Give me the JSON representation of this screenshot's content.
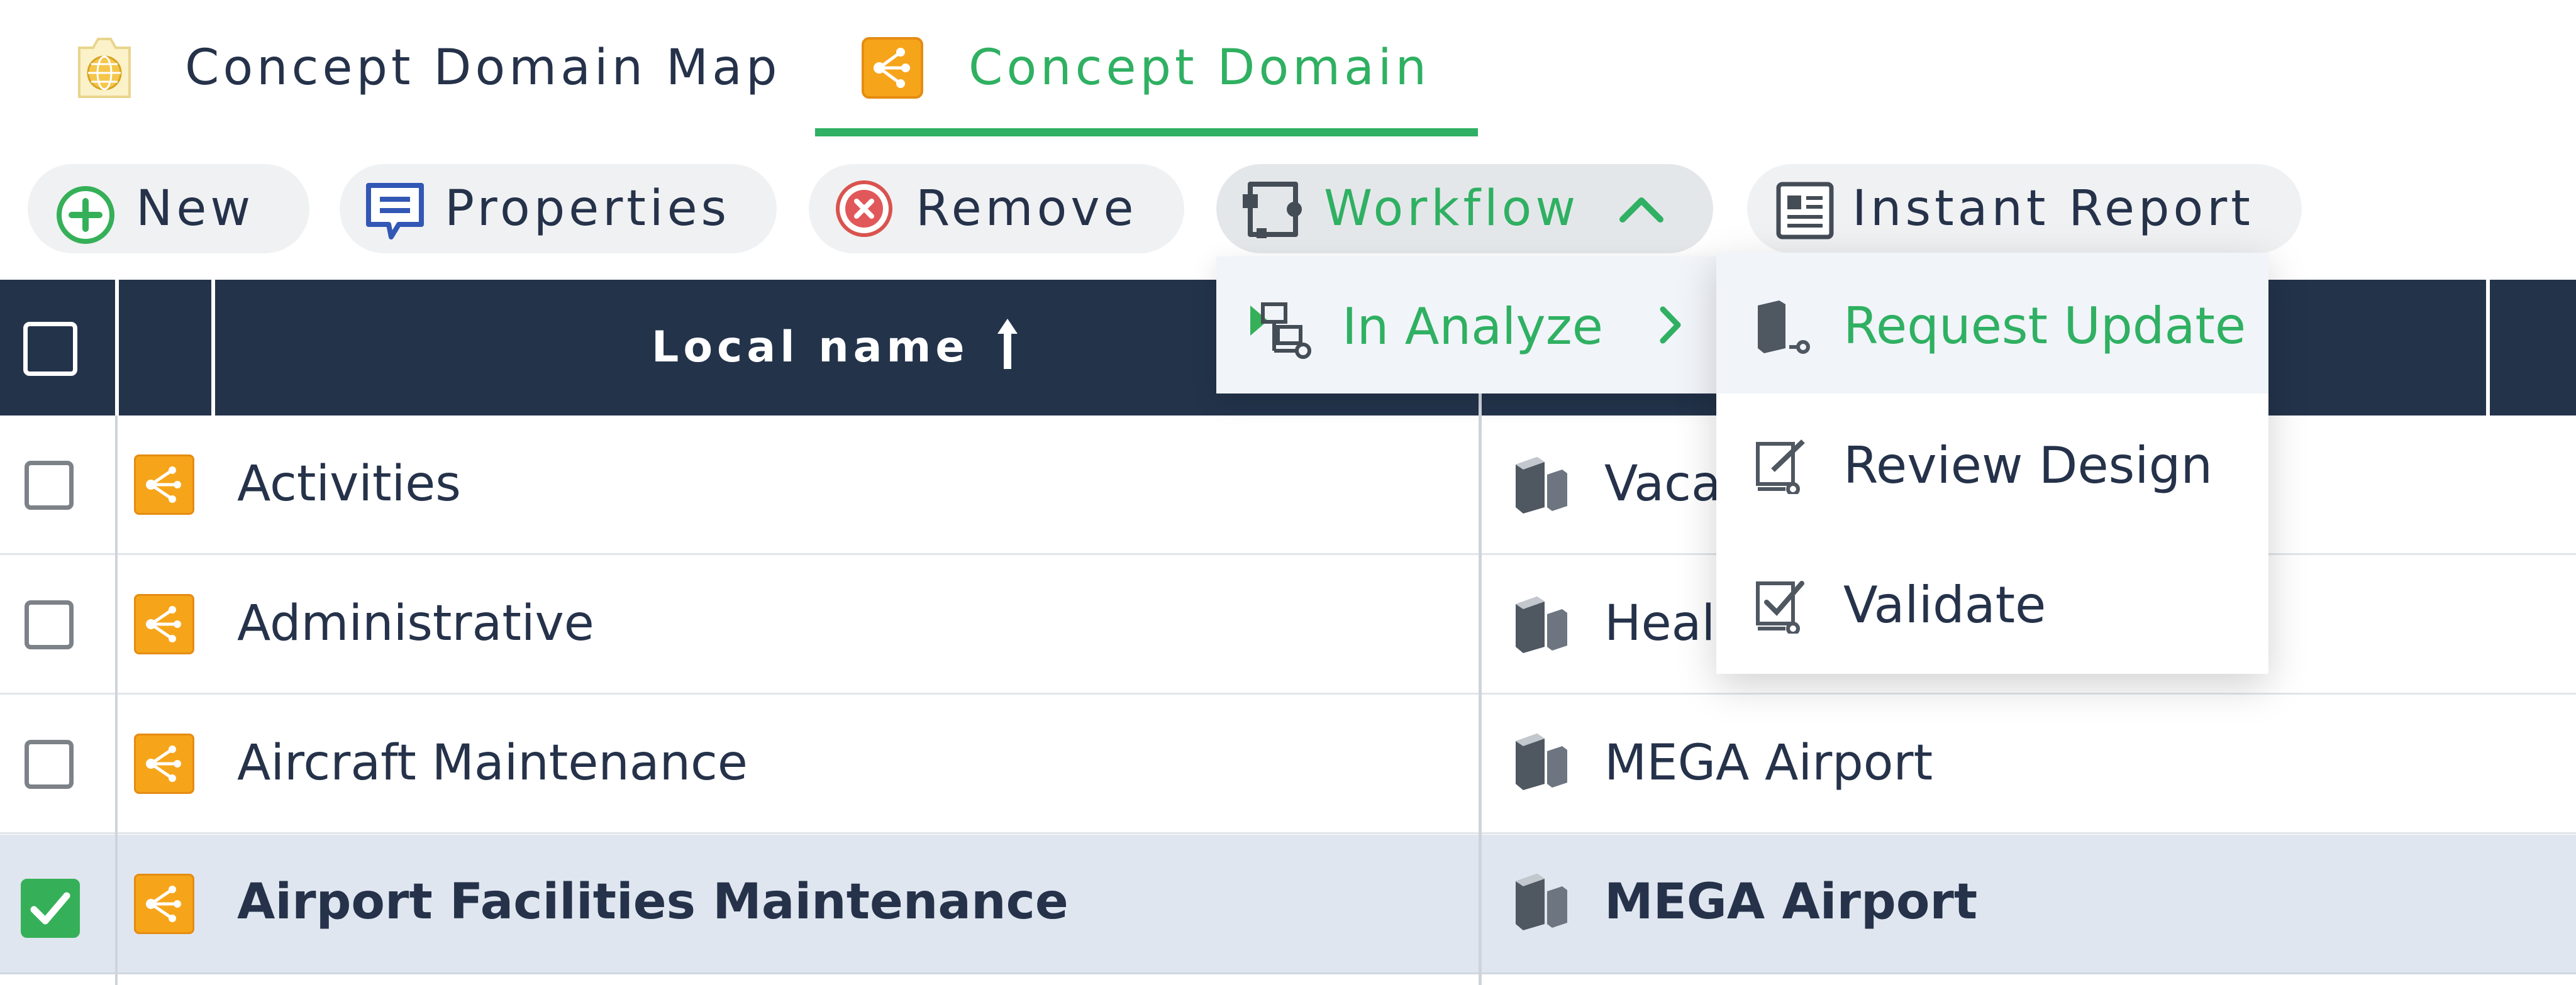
{
  "tabs": [
    {
      "label": "Concept Domain Map",
      "icon": "globe-map-icon",
      "active": false
    },
    {
      "label": "Concept Domain",
      "icon": "concept-domain-icon",
      "active": true
    }
  ],
  "toolbar": {
    "new_label": "New",
    "properties_label": "Properties",
    "remove_label": "Remove",
    "workflow_label": "Workflow",
    "instant_report_label": "Instant Report"
  },
  "table": {
    "columns": [
      {
        "label": "Local name",
        "sort": "ascending"
      },
      {
        "label": ""
      }
    ],
    "rows": [
      {
        "name": "Activities",
        "library": "Vaca",
        "checked": false
      },
      {
        "name": "Administrative",
        "library": "Heal",
        "checked": false
      },
      {
        "name": "Aircraft Maintenance",
        "library": "MEGA Airport",
        "checked": false
      },
      {
        "name": "Airport Facilities Maintenance",
        "library": "MEGA Airport",
        "checked": true
      }
    ]
  },
  "workflow_menu": {
    "items": [
      {
        "label": "In Analyze",
        "icon": "workflow-status-icon",
        "has_submenu": true
      }
    ],
    "submenu": [
      {
        "label": "Request Update",
        "icon": "request-update-icon",
        "highlighted": true
      },
      {
        "label": "Review Design",
        "icon": "review-design-icon",
        "highlighted": false
      },
      {
        "label": "Validate",
        "icon": "validate-icon",
        "highlighted": false
      }
    ]
  },
  "colors": {
    "accent_green": "#2fb062",
    "header_navy": "#23334a",
    "selected_row": "#dfe6ef",
    "text": "#25324a",
    "domain_orange": "#f6a51a"
  }
}
